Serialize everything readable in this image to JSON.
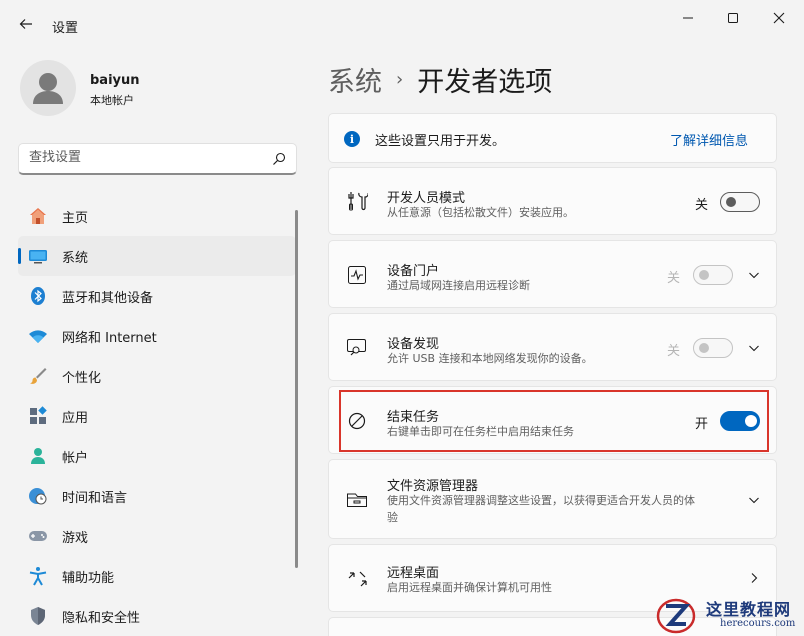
{
  "window": {
    "title": "设置",
    "controls": {
      "minimize": "minimize-icon",
      "maximize": "maximize-icon",
      "close": "close-icon"
    }
  },
  "profile": {
    "name": "baiyun",
    "account_type": "本地帐户"
  },
  "search": {
    "placeholder": "查找设置"
  },
  "sidebar": {
    "items": [
      {
        "label": "主页",
        "icon": "home-icon",
        "active": false
      },
      {
        "label": "系统",
        "icon": "system-icon",
        "active": true
      },
      {
        "label": "蓝牙和其他设备",
        "icon": "bluetooth-icon",
        "active": false
      },
      {
        "label": "网络和 Internet",
        "icon": "wifi-icon",
        "active": false
      },
      {
        "label": "个性化",
        "icon": "brush-icon",
        "active": false
      },
      {
        "label": "应用",
        "icon": "apps-icon",
        "active": false
      },
      {
        "label": "帐户",
        "icon": "account-icon",
        "active": false
      },
      {
        "label": "时间和语言",
        "icon": "clock-globe-icon",
        "active": false
      },
      {
        "label": "游戏",
        "icon": "gamepad-icon",
        "active": false
      },
      {
        "label": "辅助功能",
        "icon": "accessibility-icon",
        "active": false
      },
      {
        "label": "隐私和安全性",
        "icon": "shield-icon",
        "active": false
      }
    ]
  },
  "breadcrumb": {
    "parent": "系统",
    "separator": "›",
    "current": "开发者选项"
  },
  "info_banner": {
    "text": "这些设置只用于开发。",
    "link": "了解详细信息"
  },
  "settings": [
    {
      "title": "开发人员模式",
      "desc": "从任意源（包括松散文件）安装应用。",
      "toggle_label": "关",
      "toggle_state": "off",
      "enabled": true,
      "expandable": false
    },
    {
      "title": "设备门户",
      "desc": "通过局域网连接启用远程诊断",
      "toggle_label": "关",
      "toggle_state": "off",
      "enabled": false,
      "expandable": true
    },
    {
      "title": "设备发现",
      "desc": "允许 USB 连接和本地网络发现你的设备。",
      "toggle_label": "关",
      "toggle_state": "off",
      "enabled": false,
      "expandable": true
    },
    {
      "title": "结束任务",
      "desc": "右键单击即可在任务栏中启用结束任务",
      "toggle_label": "开",
      "toggle_state": "on",
      "enabled": true,
      "expandable": false
    },
    {
      "title": "文件资源管理器",
      "desc_line1": "使用文件资源管理器调整这些设置，以获得更适合开发人员的体",
      "desc_line2": "验",
      "expandable": true
    },
    {
      "title": "远程桌面",
      "desc": "启用远程桌面并确保计算机可用性",
      "navigable": true
    }
  ],
  "watermark": {
    "title": "这里教程网",
    "url": "herecours.com"
  },
  "colors": {
    "accent": "#0067c0",
    "highlight_border": "#d9352b"
  }
}
